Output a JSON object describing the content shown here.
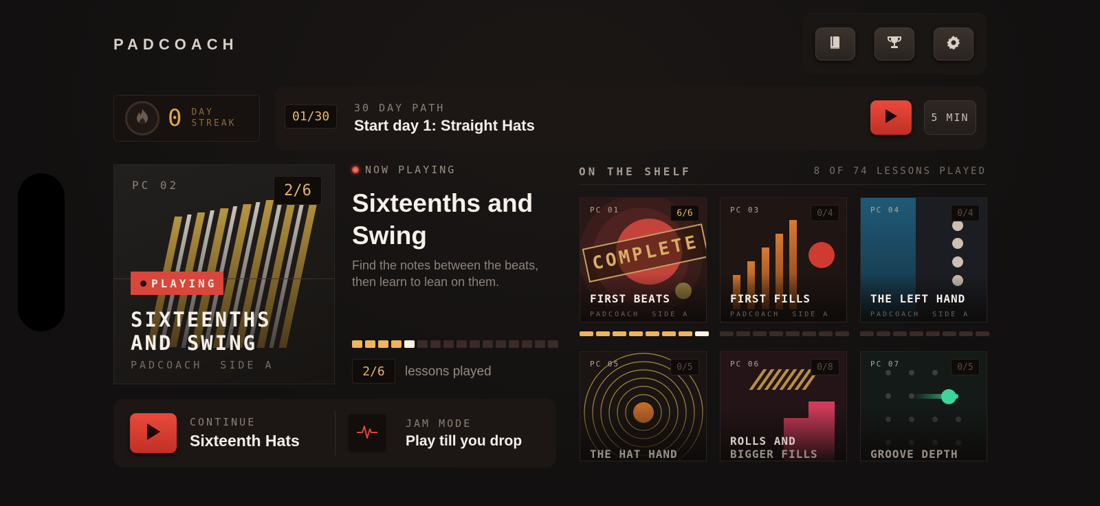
{
  "brand": "PADCOACH",
  "icons": {
    "book": "book-icon",
    "trophy": "trophy-icon",
    "settings": "gear-icon",
    "flame": "flame-icon",
    "play": "play-icon",
    "pulse": "pulse-icon"
  },
  "streak": {
    "count": "0",
    "label_line1": "DAY",
    "label_line2": "STREAK"
  },
  "path": {
    "counter": "01/30",
    "kicker": "30 DAY PATH",
    "title": "Start day 1: Straight Hats",
    "duration": "5 MIN"
  },
  "album": {
    "code": "PC 02",
    "badge": "2/6",
    "tag": "PLAYING",
    "title_line1": "SIXTEENTHS",
    "title_line2": "AND SWING",
    "sub": "PADCOACH  SIDE A"
  },
  "now_playing": {
    "kicker": "NOW PLAYING",
    "title": "Sixteenths and Swing",
    "description": "Find the notes between the beats, then learn to lean on them.",
    "progress": {
      "done": 4,
      "current": 5,
      "total": 16
    },
    "count": "2/6",
    "count_label": "lessons played"
  },
  "continue": {
    "kicker": "CONTINUE",
    "title": "Sixteenth Hats"
  },
  "jam": {
    "kicker": "JAM MODE",
    "title": "Play till you drop"
  },
  "shelf": {
    "heading": "ON THE SHELF",
    "count": "8 OF 74 LESSONS PLAYED",
    "cards": [
      {
        "code": "PC 01",
        "badge": "6/6",
        "title": "FIRST BEATS",
        "sub": "PADCOACH  SIDE A",
        "stamp": "COMPLETE"
      },
      {
        "code": "PC 03",
        "badge": "0/4",
        "title": "FIRST FILLS",
        "sub": "PADCOACH  SIDE A"
      },
      {
        "code": "PC 04",
        "badge": "0/4",
        "title": "THE LEFT HAND",
        "sub": "PADCOACH  SIDE A"
      },
      {
        "code": "PC 05",
        "badge": "0/5",
        "title": "THE HAT HAND"
      },
      {
        "code": "PC 06",
        "badge": "0/8",
        "title_line1": "ROLLS AND",
        "title_line2": "BIGGER FILLS"
      },
      {
        "code": "PC 07",
        "badge": "0/5",
        "title": "GROOVE DEPTH"
      }
    ]
  },
  "colors": {
    "accent": "#e0443a",
    "amber": "#f0b45b",
    "background": "#141110"
  }
}
